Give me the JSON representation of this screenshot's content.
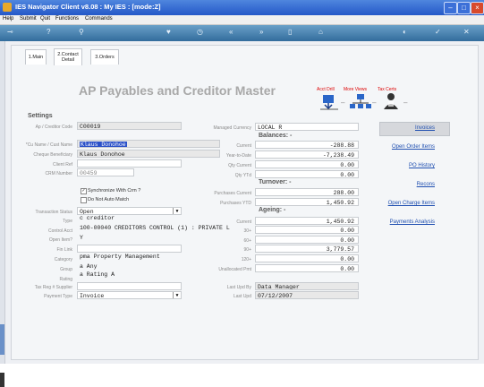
{
  "window": {
    "title": "IES Navigator Client v8.08 : My IES :     [mode:Z]"
  },
  "menu": [
    "Help",
    "Submit",
    "Quit",
    "Functions",
    "Commands"
  ],
  "toolbar_icons": [
    "key-icon",
    "help-icon",
    "search-icon",
    "heart-icon",
    "clock-icon",
    "back-icon",
    "forward-icon",
    "document-icon",
    "home-icon",
    "globe-icon",
    "check-icon",
    "close-icon"
  ],
  "tabs": [
    {
      "label": "1.Main"
    },
    {
      "label_line1": "2.Contact",
      "label_line2": "Detail"
    },
    {
      "label": "3.Orders"
    }
  ],
  "heading": "AP Payables and Creditor Master",
  "action_icons": {
    "acct_drill": "Acct Drill",
    "more_views": "More Views",
    "tax_certs": "Tax Certs"
  },
  "settings": {
    "title": "Settings",
    "ap_creditor_code_label": "Ap / Creditor Code",
    "ap_creditor_code": "C00019",
    "name_label": "*Cu Name / Cust Name",
    "name": "Klaus Donohoe",
    "beneficiary_label": "Cheque Beneficiary",
    "beneficiary": "Klaus Donohoe",
    "client_ref_label": "Client Ref",
    "crm_number_label": "CRM Number",
    "crm_number": "00459",
    "sync_crm_label": "Synchronize With Crm ?",
    "no_auto_match_label": "Do Not Auto Match",
    "transaction_status_label": "Transaction Status",
    "transaction_status": "Open",
    "type_label": "Type",
    "type": "c creditor",
    "control_acct_label": "Control Acct",
    "control_acct": "100-00040 CREDITORS CONTROL (1) : PRIVATE L",
    "open_item_label": "Open Item?",
    "open_item": "Y",
    "fin_link_label": "Fin Link",
    "category_label": "Category",
    "category": "pma Property Management",
    "group_label": "Group",
    "group": "a Any",
    "rating_label": "Rating",
    "rating": "a Rating A",
    "tax_reg_label": "Tax Reg # Supplier",
    "payment_type_label": "Payment Type",
    "payment_type": "Invoice"
  },
  "right": {
    "managed_currency_label": "Managed Currency",
    "managed_currency": "LOCAL R",
    "balances_title": "Balances: -",
    "current_label": "Current",
    "current": "-288.88",
    "ytd_label": "Year-to-Date",
    "ytd": "-7,238.49",
    "qty_current_label": "Qty Current",
    "qty_current": "0.00",
    "qty_ytd_label": "Qty YTd",
    "qty_ytd": "0.00",
    "turnover_title": "Turnover: -",
    "purchases_current_label": "Purchases Current",
    "purchases_current": "288.00",
    "purchases_ytd_label": "Purchases YTD",
    "purchases_ytd": "1,450.92",
    "ageing_title": "Ageing: -",
    "ageing_current_label": "Current",
    "ageing_current": "1,450.92",
    "d30_label": "30+",
    "d30": "0.00",
    "d60_label": "60+",
    "d60": "0.00",
    "d90_label": "90+",
    "d90": "3,779.57",
    "d120_label": "120+",
    "d120": "0.00",
    "unallocated_label": "Unallocated Pmt",
    "unallocated": "0.00",
    "last_upd_by_label": "Last Upd By",
    "last_upd_by": "Data Manager",
    "last_upd_label": "Last Upd",
    "last_upd": "07/12/2007"
  },
  "links": {
    "invoices": "Invoices",
    "open_order_items": "Open Order Items",
    "po_history": "PO History",
    "recons": "Recons",
    "open_charge_items": "Open Charge Items",
    "payments_analysis": "Payments Analysis"
  }
}
